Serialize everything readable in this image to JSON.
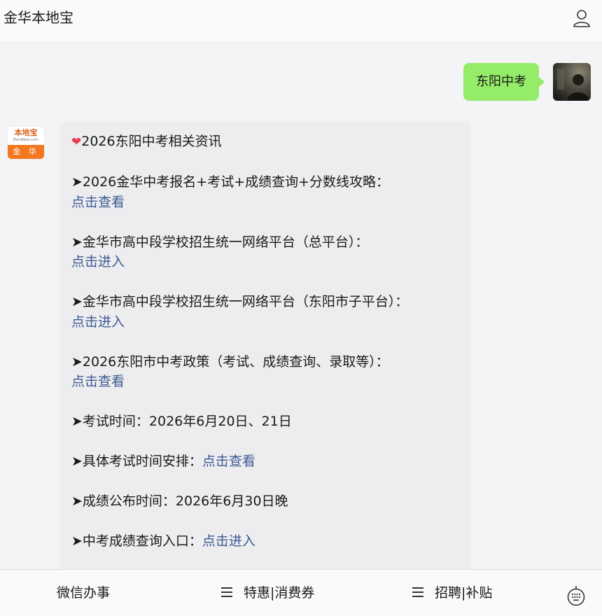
{
  "header": {
    "title": "金华本地宝",
    "user_icon": "user-icon"
  },
  "user_message": {
    "text": "东阳中考"
  },
  "bot_avatar": {
    "brand": "本地宝",
    "url": "Bendibao.com",
    "city": "金 华"
  },
  "bot_message": {
    "title": "2026东阳中考相关资讯",
    "items": [
      {
        "label": "➤2026金华中考报名+考试+成绩查询+分数线攻略：",
        "link": "点击查看"
      },
      {
        "label": "➤金华市高中段学校招生统一网络平台（总平台）：",
        "link": "点击进入"
      },
      {
        "label": "➤金华市高中段学校招生统一网络平台（东阳市子平台）：",
        "link": "点击进入"
      },
      {
        "label": "➤2026东阳市中考政策（考试、成绩查询、录取等）：",
        "link": "点击查看"
      }
    ],
    "exam_time": "➤考试时间：2026年6月20日、21日",
    "schedule_label": "➤具体考试时间安排：",
    "schedule_link": "点击查看",
    "publish_time": "➤成绩公布时间：2026年6月30日晚",
    "query_label": "➤中考成绩查询入口：",
    "query_link": "点击进入"
  },
  "footer": {
    "menu1": "微信办事",
    "menu2": "特惠|消费券",
    "menu3": "招聘|补贴",
    "keyboard_icon": "keyboard-icon"
  },
  "colors": {
    "user_bubble": "#95ec69",
    "bot_bubble": "#ededf0",
    "link": "#3b5b92",
    "heart": "#e83e4f",
    "brand_orange": "#f4781f"
  }
}
